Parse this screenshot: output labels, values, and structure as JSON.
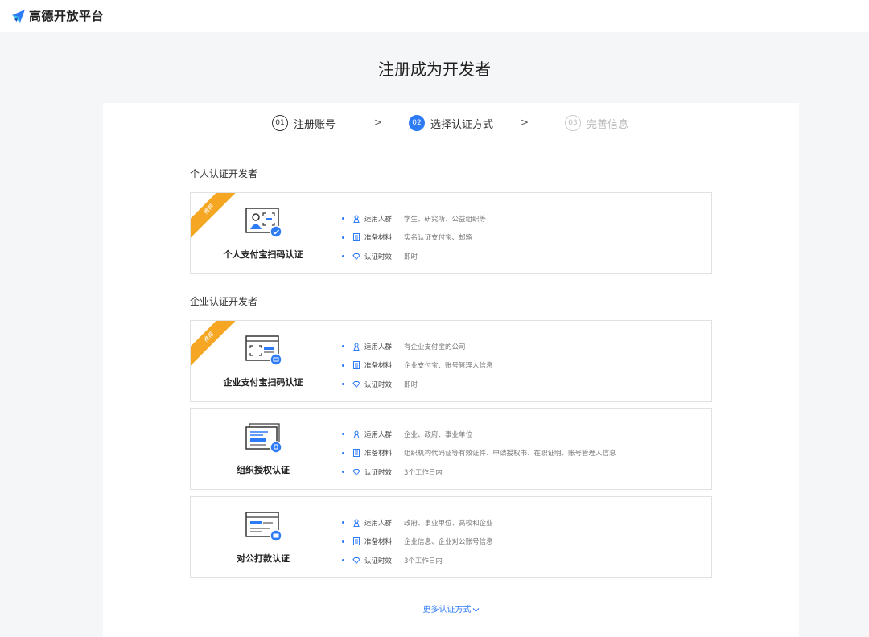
{
  "app": {
    "logo_text": "高德开放平台"
  },
  "page": {
    "title": "注册成为开发者"
  },
  "steps": [
    {
      "num": "01",
      "label": "注册账号",
      "state": "done"
    },
    {
      "num": "02",
      "label": "选择认证方式",
      "state": "active"
    },
    {
      "num": "03",
      "label": "完善信息",
      "state": "pending"
    }
  ],
  "step_separator": ">",
  "sections": {
    "personal": "个人认证开发者",
    "enterprise": "企业认证开发者"
  },
  "info_labels": {
    "audience": "适用人群",
    "materials": "准备材料",
    "duration": "认证时效"
  },
  "cards": [
    {
      "name": "个人支付宝扫码认证",
      "ribbon": "推荐",
      "audience": "学生、研究所、公益组织等",
      "materials": "实名认证支付宝、邮箱",
      "duration": "即时"
    },
    {
      "name": "企业支付宝扫码认证",
      "ribbon": "推荐",
      "audience": "有企业支付宝的公司",
      "materials": "企业支付宝、账号管理人信息",
      "duration": "即时"
    },
    {
      "name": "组织授权认证",
      "ribbon": "",
      "audience": "企业、政府、事业单位",
      "materials": "组织机构代码证等有效证件、申请授权书、在职证明、账号管理人信息",
      "duration": "3个工作日内"
    },
    {
      "name": "对公打款认证",
      "ribbon": "",
      "audience": "政府、事业单位、高校和企业",
      "materials": "企业信息、企业对公账号信息",
      "duration": "3个工作日内"
    }
  ],
  "more_link": "更多认证方式",
  "icons": {
    "logo": "gaode-logo-icon",
    "audience": "person-icon",
    "materials": "document-icon",
    "duration": "diamond-icon",
    "more": "chevron-down-icon"
  },
  "colors": {
    "accent": "#2e7bf6",
    "ribbon": "#f5a623",
    "background": "#f5f6f7"
  }
}
